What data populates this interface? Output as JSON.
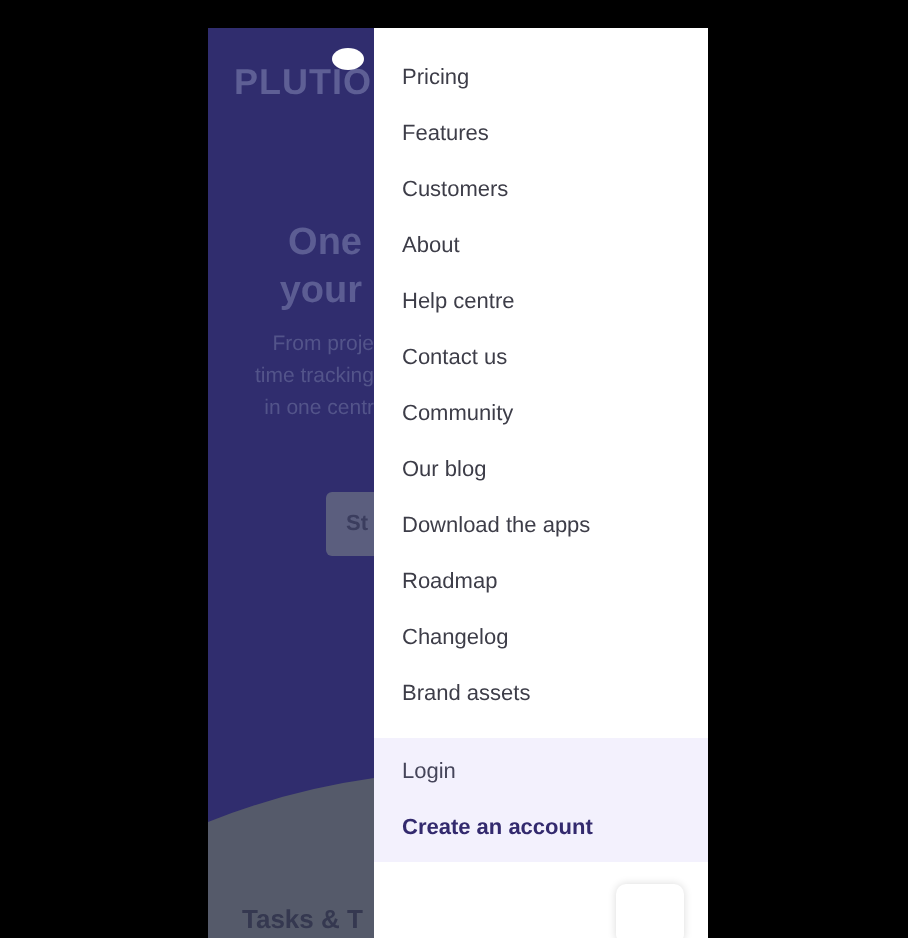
{
  "background": {
    "logo": "PLUTIO",
    "heading_lines": [
      "One",
      "your"
    ],
    "subtitle_lines": [
      "From proje",
      "time tracking",
      "in one centr"
    ],
    "button": "St",
    "section_title": "Tasks & T"
  },
  "menu": {
    "items": [
      {
        "label": "Pricing"
      },
      {
        "label": "Features"
      },
      {
        "label": "Customers"
      },
      {
        "label": "About"
      },
      {
        "label": "Help centre"
      },
      {
        "label": "Contact us"
      },
      {
        "label": "Community"
      },
      {
        "label": "Our blog"
      },
      {
        "label": "Download the apps"
      },
      {
        "label": "Roadmap"
      },
      {
        "label": "Changelog"
      },
      {
        "label": "Brand assets"
      }
    ]
  },
  "account": [
    {
      "label": "Login",
      "kind": "link"
    },
    {
      "label": "Create an account",
      "kind": "primary"
    }
  ]
}
